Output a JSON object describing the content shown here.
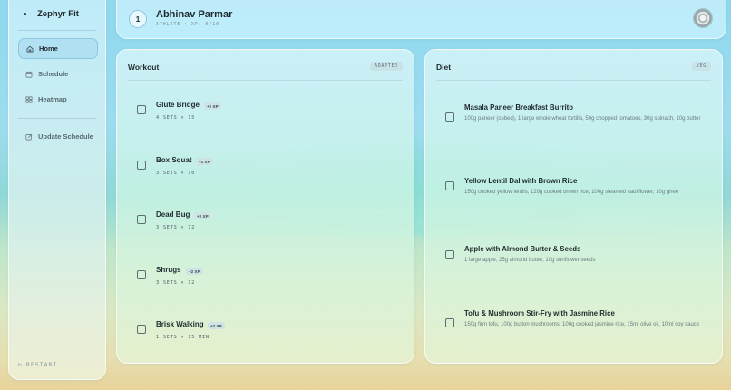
{
  "app": {
    "brand": "Zephyr Fit",
    "restart_label": "RESTART"
  },
  "sidebar": {
    "items": [
      {
        "label": "Home",
        "icon": "home-icon",
        "active": true
      },
      {
        "label": "Schedule",
        "icon": "calendar-icon",
        "active": false
      },
      {
        "label": "Heatmap",
        "icon": "grid-icon",
        "active": false
      }
    ],
    "update_label": "Update Schedule"
  },
  "header": {
    "level": "1",
    "user_name": "Abhinav Parmar",
    "user_meta": "ATHLETE • XP: 0/10"
  },
  "workout": {
    "title": "Workout",
    "tag": "ADAPTED",
    "exercises": [
      {
        "name": "Glute Bridge",
        "xp": "+2 XP",
        "sets": "4 SETS × 15"
      },
      {
        "name": "Box Squat",
        "xp": "+1 XP",
        "sets": "3 SETS × 10"
      },
      {
        "name": "Dead Bug",
        "xp": "+2 XP",
        "sets": "3 SETS × 12"
      },
      {
        "name": "Shrugs",
        "xp": "+2 XP",
        "sets": "3 SETS × 12"
      },
      {
        "name": "Brisk Walking",
        "xp": "+2 XP",
        "sets": "1 SETS × 15 MIN"
      }
    ]
  },
  "diet": {
    "title": "Diet",
    "tag": "VEG",
    "meals": [
      {
        "name": "Masala Paneer Breakfast Burrito",
        "desc": "100g paneer (cubed), 1 large whole wheat tortilla, 50g chopped tomatoes, 30g spinach, 10g butter"
      },
      {
        "name": "Yellow Lentil Dal with Brown Rice",
        "desc": "150g cooked yellow lentils, 120g cooked brown rice, 100g steamed cauliflower, 10g ghee"
      },
      {
        "name": "Apple with Almond Butter & Seeds",
        "desc": "1 large apple, 25g almond butter, 10g sunflower seeds"
      },
      {
        "name": "Tofu & Mushroom Stir-Fry with Jasmine Rice",
        "desc": "150g firm tofu, 100g button mushrooms, 100g cooked jasmine rice, 15ml olive oil, 10ml soy sauce"
      }
    ]
  }
}
